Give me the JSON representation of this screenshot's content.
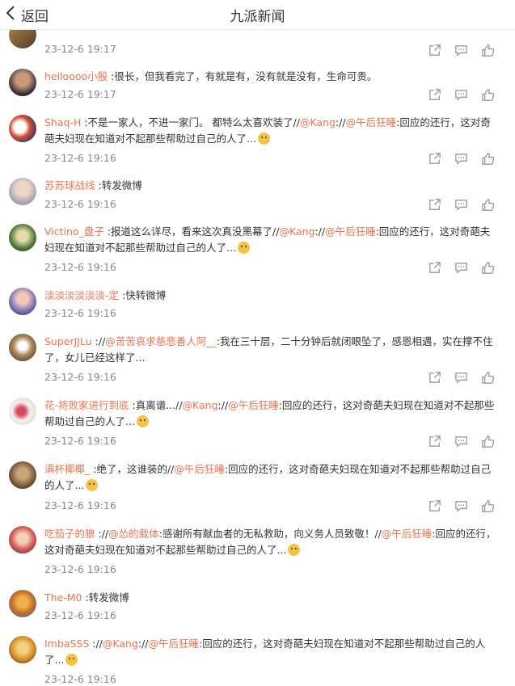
{
  "header": {
    "back_label": "返回",
    "title": "九派新闻"
  },
  "colors": {
    "link": "#eb7350",
    "time": "#888888",
    "icon": "#999999"
  },
  "comments": [
    {
      "user": "",
      "body_pre": "",
      "body": "",
      "time": "23-12-6 19:17"
    },
    {
      "user": "helloooo小殷",
      "body": " :很长，但我看完了，有就是有，没有就是没有，生命可贵。",
      "time": "23-12-6 19:17"
    },
    {
      "user": "Shaq-H",
      "body": " :不是一家人，不进一家门。   都特么太喜欢装了//",
      "m1": "@Kang",
      "sep1": "://",
      "m2": "@午后狂睡",
      "body2": ":回应的还行，这对奇葩夫妇现在知道对不起那些帮助过自己的人了...",
      "time": "23-12-6 19:16"
    },
    {
      "user": "苏苏球战线",
      "body": " :转发微博",
      "time": "23-12-6 19:16"
    },
    {
      "user": "Victino_盘子",
      "body": " :报道这么详尽，看来这次真没黑幕了//",
      "m1": "@Kang",
      "sep1": "://",
      "m2": "@午后狂睡",
      "body2": ":回应的还行，这对奇葩夫妇现在知道对不起那些帮助过自己的人了...",
      "time": "23-12-6 19:16"
    },
    {
      "user": "淡淡淡淡淡淡-定",
      "body": " :快转微博",
      "time": "23-12-6 19:16"
    },
    {
      "user": "SuperJJLu",
      "body": " ://",
      "m1": "@苦苦哀求慈悲善人阿__",
      "sep1": "",
      "m2": "",
      "body2": ":我在三十层，二十分钟后就闭眼坠了，感恩相遇，实在撑不住了，女儿已经这样了...",
      "time": "23-12-6 19:16"
    },
    {
      "user": "花-将败家进行到底",
      "body": " :真离谱...//",
      "m1": "@Kang",
      "sep1": "://",
      "m2": "@午后狂睡",
      "body2": ":回应的还行，这对奇葩夫妇现在知道对不起那些帮助过自己的人了...",
      "time": "23-12-6 19:16"
    },
    {
      "user": "满杯椰椰_",
      "body": " :绝了，这谁装的//",
      "m1": "@午后狂睡",
      "sep1": "",
      "m2": "",
      "body2": ":回应的还行，这对奇葩夫妇现在知道对不起那些帮助过自己的人了...",
      "time": "23-12-6 19:16"
    },
    {
      "user": "吃茄子的狼",
      "body": " ://",
      "m1": "@怂的载体",
      "sep1": "",
      "m2": "",
      "body2": ":感谢所有献血者的无私救助，向义务人员致敬！//",
      "m3": "@午后狂睡",
      "body3": ":回应的还行，这对奇葩夫妇现在知道对不起那些帮助过自己的人了...",
      "time": "23-12-6 19:16"
    },
    {
      "user": "The-M0",
      "body": " :转发微博",
      "time": "23-12-6 19:16"
    },
    {
      "user": "ImbaSSS",
      "body": " ://",
      "m1": "@Kang",
      "sep1": "://",
      "m2": "@午后狂睡",
      "body2": ":回应的还行，这对奇葩夫妇现在知道对不起那些帮助过自己的人了...",
      "time": "23-12-6 19:16"
    }
  ]
}
